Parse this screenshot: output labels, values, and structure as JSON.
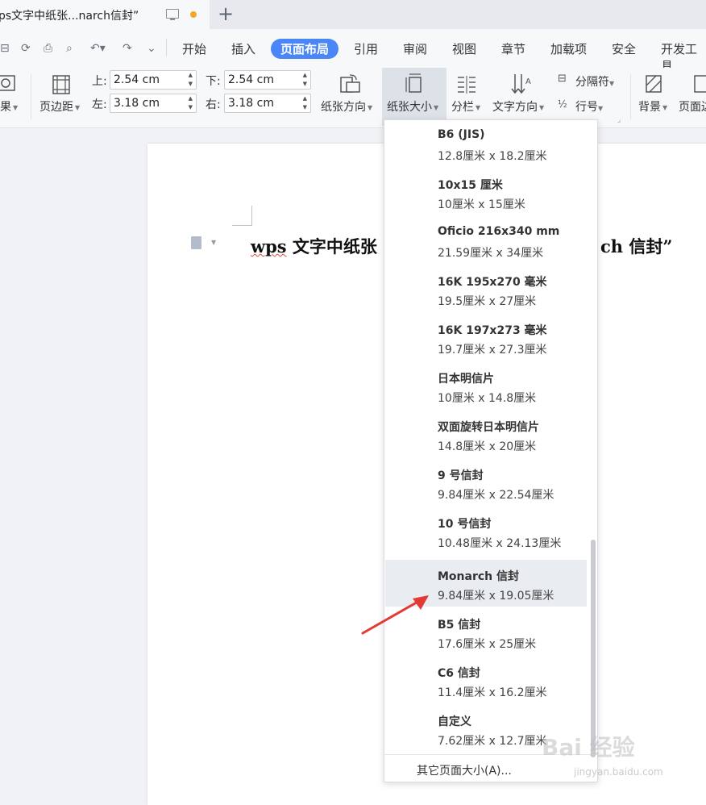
{
  "tab": {
    "title": "ps文字中纸张...narch信封”"
  },
  "menu": {
    "items": [
      "开始",
      "插入",
      "页面布局",
      "引用",
      "审阅",
      "视图",
      "章节",
      "加载项",
      "安全",
      "开发工具"
    ],
    "active": "页面布局"
  },
  "ribbon": {
    "effects_label": "果",
    "margins_label": "页边距",
    "top_label": "上:",
    "top_value": "2.54 cm",
    "bottom_label": "下:",
    "bottom_value": "2.54 cm",
    "left_label": "左:",
    "left_value": "3.18 cm",
    "right_label": "右:",
    "right_value": "3.18 cm",
    "orientation_label": "纸张方向",
    "size_label": "纸张大小",
    "columns_label": "分栏",
    "text_dir_label": "文字方向",
    "breaks_label": "分隔符",
    "line_num_label": "行号",
    "background_label": "背景",
    "page_border_label": "页面边"
  },
  "document": {
    "title_part1": "wps",
    "title_part2": " 文字中纸张",
    "title_part3": "ch 信封”"
  },
  "paper_sizes": [
    {
      "name": "B6 (JIS)",
      "dims": "12.8厘米  x  18.2厘米"
    },
    {
      "name": "10x15 厘米",
      "dims": "10厘米  x  15厘米"
    },
    {
      "name": "Oficio 216x340 mm",
      "dims": "21.59厘米  x  34厘米"
    },
    {
      "name": "16K 195x270 毫米",
      "dims": "19.5厘米  x  27厘米"
    },
    {
      "name": "16K 197x273 毫米",
      "dims": "19.7厘米  x  27.3厘米"
    },
    {
      "name": "日本明信片",
      "dims": "10厘米  x  14.8厘米"
    },
    {
      "name": "双面旋转日本明信片",
      "dims": "14.8厘米  x  20厘米"
    },
    {
      "name": "9 号信封",
      "dims": "9.84厘米  x  22.54厘米"
    },
    {
      "name": "10 号信封",
      "dims": "10.48厘米  x  24.13厘米"
    },
    {
      "name": "Monarch 信封",
      "dims": "9.84厘米  x  19.05厘米"
    },
    {
      "name": "B5 信封",
      "dims": "17.6厘米  x  25厘米"
    },
    {
      "name": "C6 信封",
      "dims": "11.4厘米  x  16.2厘米"
    },
    {
      "name": "自定义",
      "dims": "7.62厘米  x  12.7厘米"
    }
  ],
  "highlighted_item": "Monarch 信封",
  "other_sizes_label": "其它页面大小(A)...",
  "watermark": {
    "text": "Bai 经验",
    "sub": "jingyan.baidu.com"
  },
  "colors": {
    "accent": "#4a86f7",
    "arrow": "#e53935",
    "highlight": "#e9ecf1"
  }
}
